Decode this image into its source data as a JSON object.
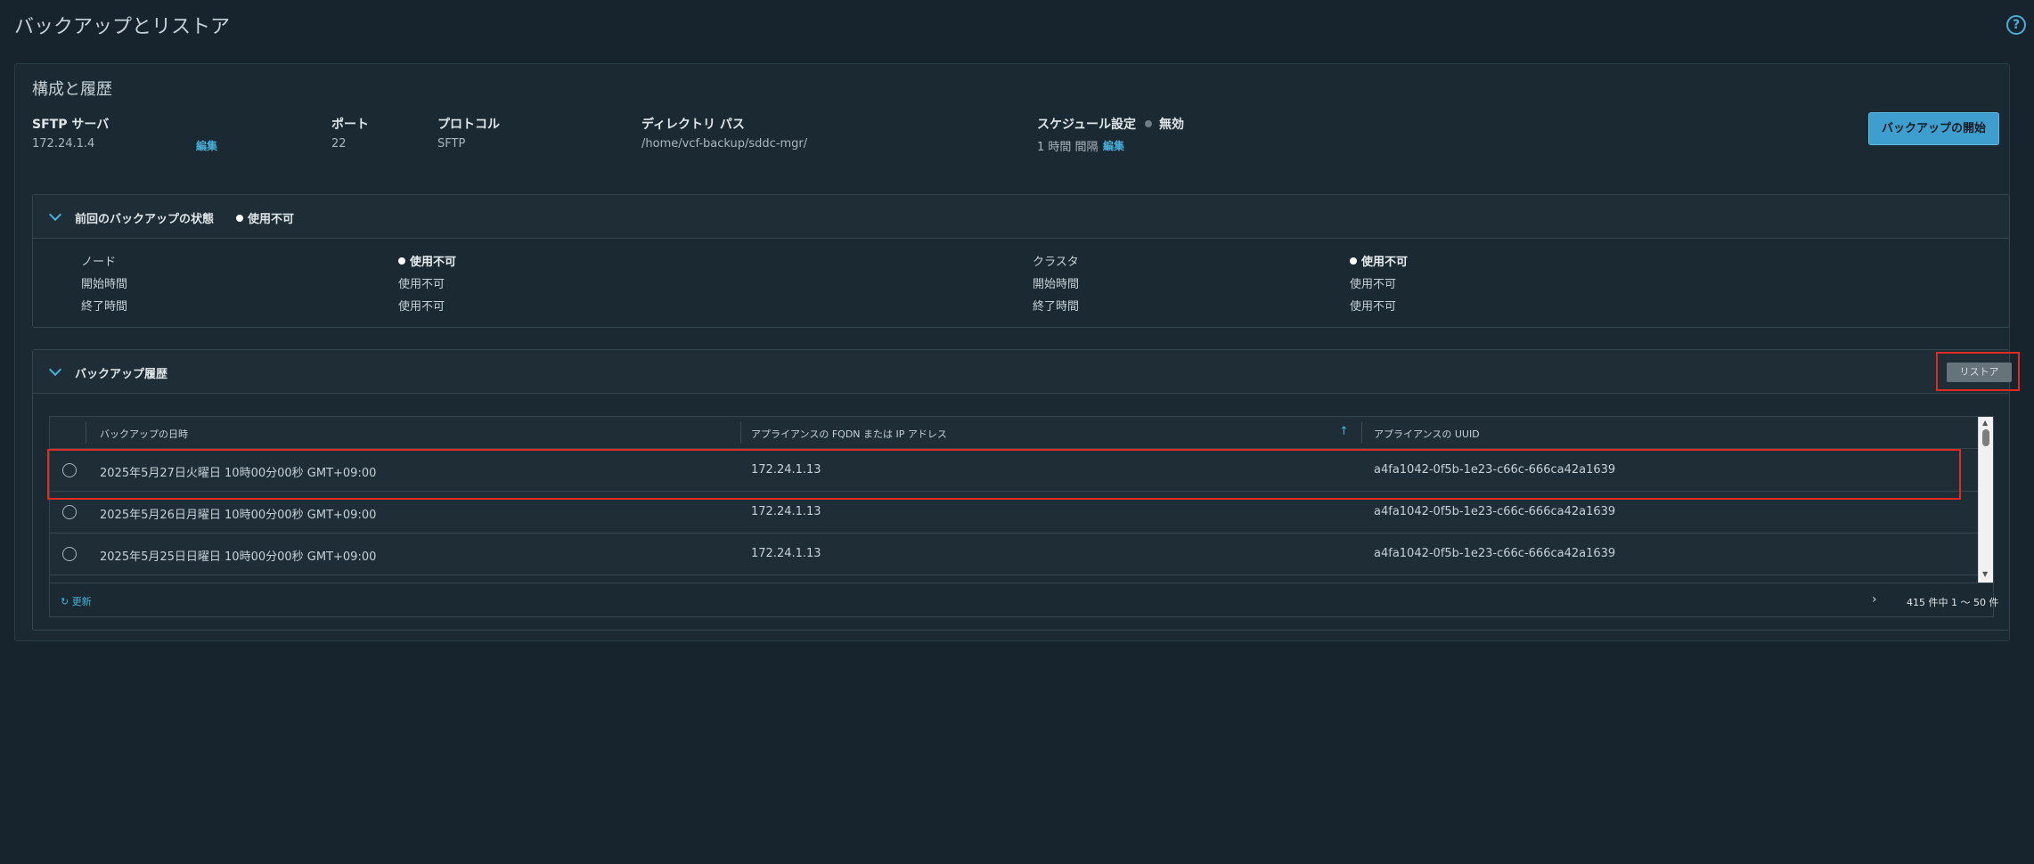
{
  "page": {
    "title": "バックアップとリストア",
    "help_icon": "?"
  },
  "config": {
    "title": "構成と履歴",
    "sftp_label": "SFTP サーバ",
    "sftp_value": "172.24.1.4",
    "sftp_edit": "編集",
    "port_label": "ポート",
    "port_value": "22",
    "protocol_label": "プロトコル",
    "protocol_value": "SFTP",
    "dir_label": "ディレクトリ パス",
    "dir_value": "/home/vcf-backup/sddc-mgr/",
    "schedule_label": "スケジュール設定",
    "schedule_status": "無効",
    "schedule_value": "1 時間 間隔",
    "schedule_edit": "編集",
    "start_button": "バックアップの開始"
  },
  "last_backup": {
    "title": "前回のバックアップの状態",
    "status": "使用不可",
    "node_label": "ノード",
    "node_status": "使用不可",
    "node_start_label": "開始時間",
    "node_start_value": "使用不可",
    "node_end_label": "終了時間",
    "node_end_value": "使用不可",
    "cluster_label": "クラスタ",
    "cluster_status": "使用不可",
    "cluster_start_label": "開始時間",
    "cluster_start_value": "使用不可",
    "cluster_end_label": "終了時間",
    "cluster_end_value": "使用不可"
  },
  "history": {
    "title": "バックアップ履歴",
    "restore_button": "リストア",
    "columns": {
      "date": "バックアップの日時",
      "fqdn": "アプライアンスの FQDN または IP アドレス",
      "uuid": "アプライアンスの UUID"
    },
    "rows": [
      {
        "date": "2025年5月27日火曜日 10時00分00秒 GMT+09:00",
        "fqdn": "172.24.1.13",
        "uuid": "a4fa1042-0f5b-1e23-c66c-666ca42a1639"
      },
      {
        "date": "2025年5月26日月曜日 10時00分00秒 GMT+09:00",
        "fqdn": "172.24.1.13",
        "uuid": "a4fa1042-0f5b-1e23-c66c-666ca42a1639"
      },
      {
        "date": "2025年5月25日日曜日 10時00分00秒 GMT+09:00",
        "fqdn": "172.24.1.13",
        "uuid": "a4fa1042-0f5b-1e23-c66c-666ca42a1639"
      }
    ],
    "refresh_label": "更新",
    "paging": "415 件中 1 ～ 50 件"
  }
}
